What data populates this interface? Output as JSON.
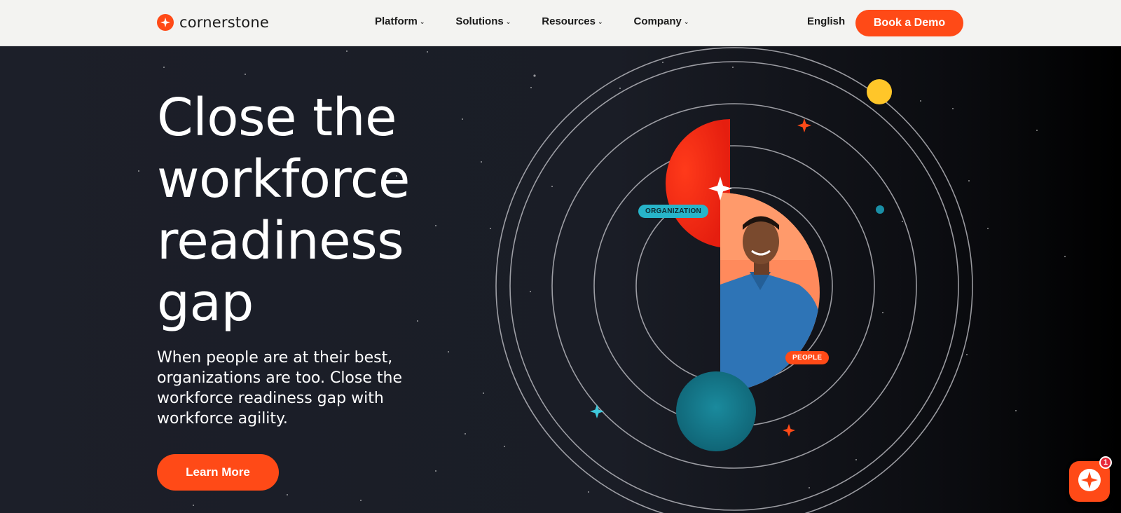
{
  "header": {
    "logo_text": "cornerstone",
    "nav": [
      {
        "label": "Platform"
      },
      {
        "label": "Solutions"
      },
      {
        "label": "Resources"
      },
      {
        "label": "Company"
      }
    ],
    "language": "English",
    "cta_label": "Book a Demo"
  },
  "hero": {
    "headline": "Close the workforce readiness gap",
    "subtext": "When people are at their best, organizations are too. Close the workforce readiness gap with workforce agility.",
    "cta_label": "Learn More",
    "tags": {
      "organization": "ORGANIZATION",
      "people": "PEOPLE"
    }
  },
  "chat": {
    "badge_count": "1"
  },
  "colors": {
    "brand_orange": "#ff4a17",
    "hero_bg": "#1b1e27",
    "teal": "#27b4c9",
    "yellow": "#ffc629"
  },
  "icons": {
    "logo": "cornerstone-star-icon",
    "chevron": "chevron-down-icon",
    "chat": "chat-assistant-icon"
  }
}
